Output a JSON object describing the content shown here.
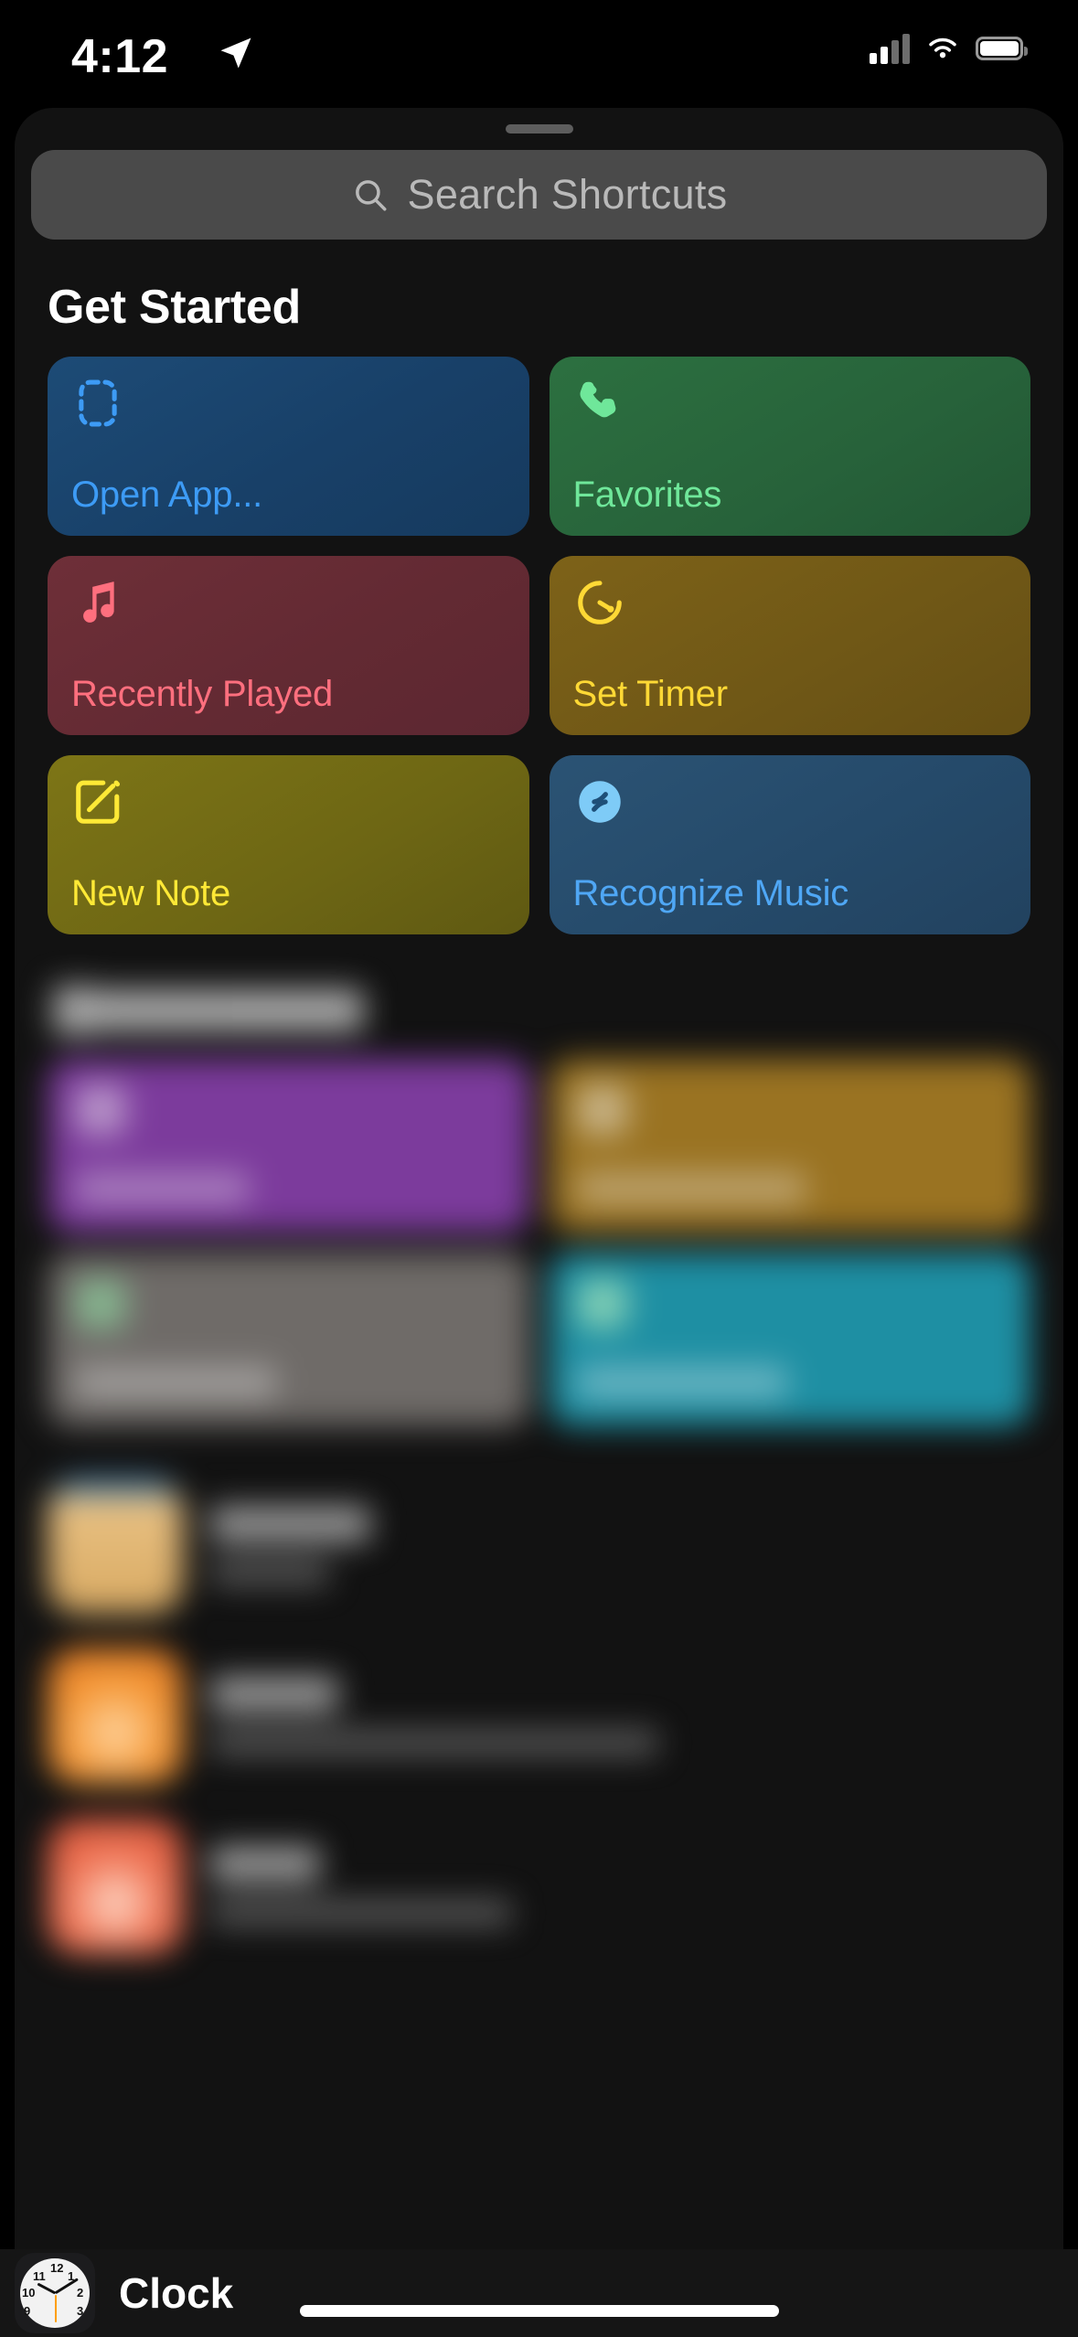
{
  "status_bar": {
    "time": "4:12",
    "location_icon": "location-arrow-icon",
    "cellular_icon": "cellular-signal-icon",
    "cellular_bars": 2,
    "cellular_bars_total": 4,
    "wifi_icon": "wifi-icon",
    "battery_icon": "battery-icon"
  },
  "sheet": {
    "grabber": "sheet-grabber"
  },
  "search": {
    "placeholder": "Search Shortcuts",
    "icon": "search-icon",
    "value": ""
  },
  "get_started": {
    "title": "Get Started",
    "cards": [
      {
        "label": "Open App...",
        "icon": "open-app-dashed-square-icon",
        "icon_color": "#3d9bf5",
        "text_color": "#3d9bf5",
        "card_color": "#1d4b76"
      },
      {
        "label": "Favorites",
        "icon": "phone-handset-icon",
        "icon_color": "#6fe79a",
        "text_color": "#6fe79a",
        "card_color": "#2c7040"
      },
      {
        "label": "Recently Played",
        "icon": "music-note-icon",
        "icon_color": "#ff6f7e",
        "text_color": "#ff6f7e",
        "card_color": "#6e2f38"
      },
      {
        "label": "Set Timer",
        "icon": "timer-icon",
        "icon_color": "#ffd935",
        "text_color": "#ffd935",
        "card_color": "#7d6218"
      },
      {
        "label": "New Note",
        "icon": "square-and-pencil-icon",
        "icon_color": "#ffe936",
        "text_color": "#ffe936",
        "card_color": "#7d7516"
      },
      {
        "label": "Recognize Music",
        "icon": "shazam-icon",
        "icon_color": "#7ecbf7",
        "text_color": "#4fa7f5",
        "card_color": "#2b5374"
      }
    ]
  },
  "redacted_section": {
    "note": "blurred-section-content-not-legible",
    "cards": [
      {
        "accent_color": "#7c3b9c"
      },
      {
        "accent_color": "#9a7322"
      },
      {
        "accent_color": "#6f6b68"
      },
      {
        "accent_color": "#1e8fa3"
      }
    ],
    "rows": [
      {
        "accent_color": "#e9c183"
      },
      {
        "accent_color": "#f59a3a"
      },
      {
        "accent_color": "#f1795a"
      }
    ]
  },
  "bottom_bar": {
    "app_label": "Clock",
    "app_icon": "clock-app-icon",
    "clock_numerals": [
      "12",
      "1",
      "2",
      "3",
      "9",
      "10",
      "11"
    ],
    "home_indicator": "home-indicator"
  },
  "theme": {
    "background": "#000000",
    "sheet_background": "#121212",
    "search_background": "#4a4a4a",
    "placeholder_color": "#b9b9b9",
    "heading_color": "#ffffff"
  }
}
